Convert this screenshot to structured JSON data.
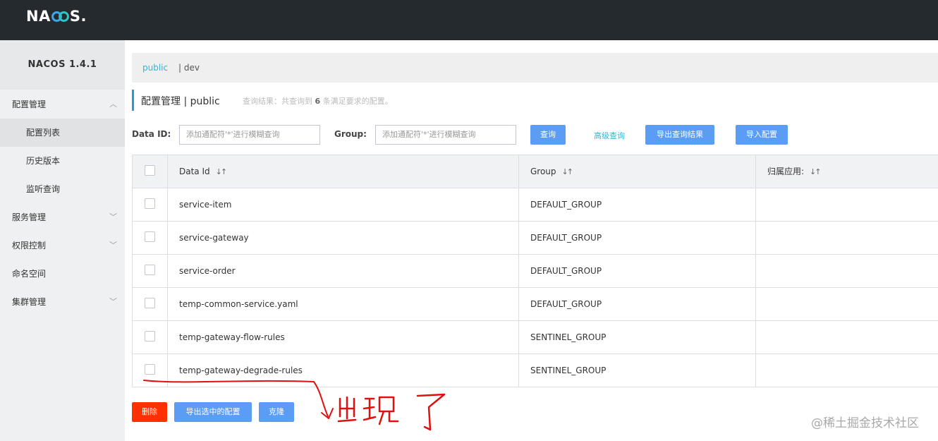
{
  "brand": {
    "logo": "NACOS.",
    "version": "NACOS 1.4.1"
  },
  "sidebar": {
    "items": [
      {
        "label": "配置管理",
        "chevron": "^"
      },
      {
        "label": "配置列表"
      },
      {
        "label": "历史版本"
      },
      {
        "label": "监听查询"
      },
      {
        "label": "服务管理",
        "chevron": "v"
      },
      {
        "label": "权限控制",
        "chevron": "v"
      },
      {
        "label": "命名空间"
      },
      {
        "label": "集群管理",
        "chevron": "v"
      }
    ]
  },
  "namespace": {
    "active": "public",
    "other": "| dev"
  },
  "page": {
    "title": "配置管理 | public",
    "result_prefix": "查询结果：共查询到",
    "result_count": "6",
    "result_suffix": "条满足要求的配置。"
  },
  "search": {
    "dataid_label": "Data ID:",
    "dataid_placeholder": "添加通配符'*'进行模糊查询",
    "group_label": "Group:",
    "group_placeholder": "添加通配符'*'进行模糊查询",
    "query_button": "查询",
    "advanced_link": "高级查询",
    "export_button": "导出查询结果",
    "import_button": "导入配置"
  },
  "table": {
    "headers": {
      "dataid": "Data Id",
      "group": "Group",
      "app": "归属应用:",
      "sort_icon": "↓↑"
    },
    "rows": [
      {
        "dataid": "service-item",
        "group": "DEFAULT_GROUP"
      },
      {
        "dataid": "service-gateway",
        "group": "DEFAULT_GROUP"
      },
      {
        "dataid": "service-order",
        "group": "DEFAULT_GROUP"
      },
      {
        "dataid": "temp-common-service.yaml",
        "group": "DEFAULT_GROUP"
      },
      {
        "dataid": "temp-gateway-flow-rules",
        "group": "SENTINEL_GROUP"
      },
      {
        "dataid": "temp-gateway-degrade-rules",
        "group": "SENTINEL_GROUP"
      }
    ]
  },
  "footer": {
    "delete_button": "删除",
    "export_selected_button": "导出选中的配置",
    "clone_button": "克隆"
  },
  "annotation": {
    "handwritten_text": "出现了",
    "color": "#e01010"
  },
  "watermark": "@稀土掘金技术社区"
}
